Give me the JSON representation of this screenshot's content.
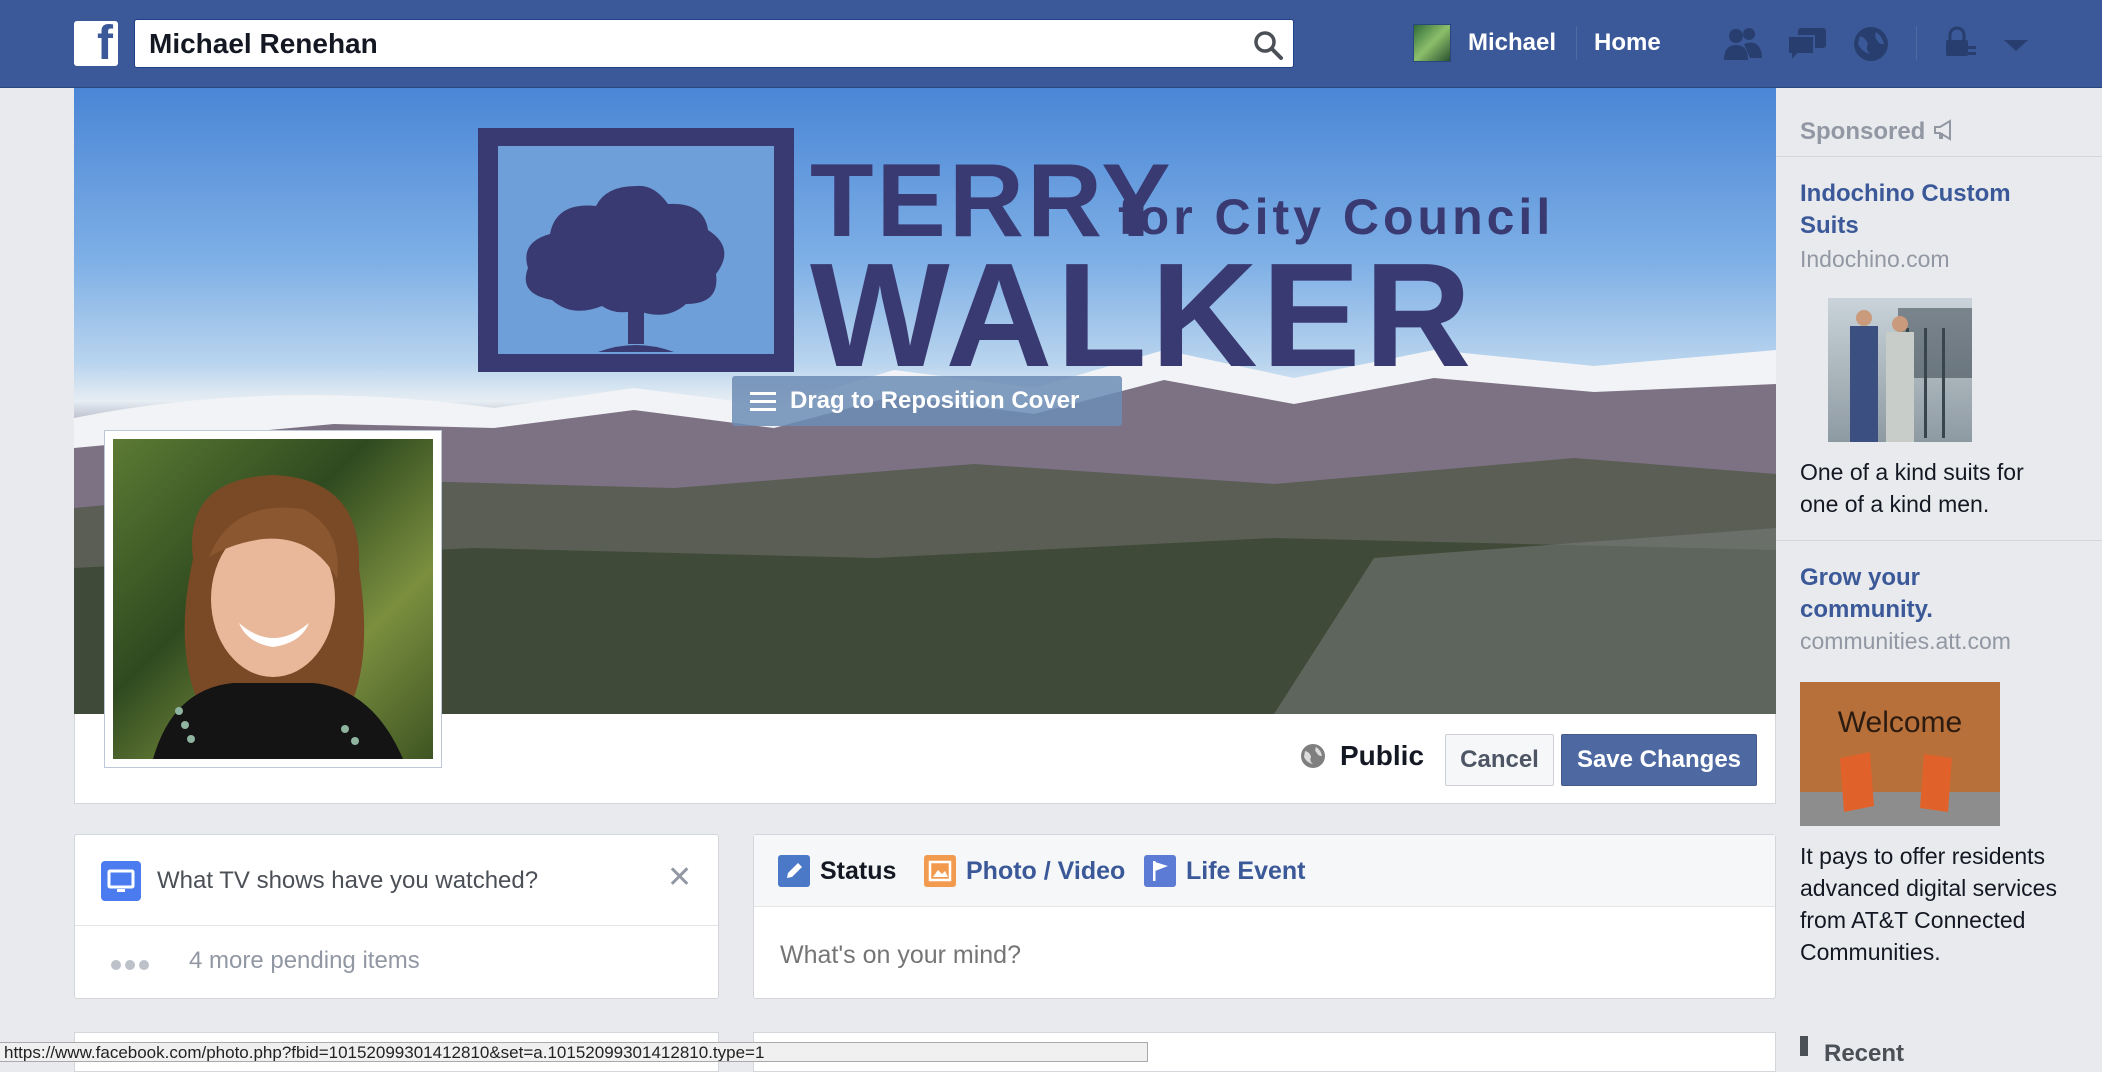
{
  "topbar": {
    "search_value": "Michael Renehan",
    "user_name": "Michael",
    "home_label": "Home",
    "icons": [
      "facebook-logo",
      "search-icon",
      "friend-requests-icon",
      "messages-icon",
      "notifications-globe-icon",
      "privacy-lock-icon",
      "account-menu-chevron-icon"
    ]
  },
  "cover": {
    "logo_line1": "TERRY",
    "logo_line2": "for City Council",
    "logo_line3": "WALKER",
    "drag_label": "Drag to Reposition Cover"
  },
  "header_actions": {
    "privacy_label": "Public",
    "cancel_label": "Cancel",
    "save_label": "Save Changes"
  },
  "tv_card": {
    "question": "What TV shows have you watched?",
    "close_glyph": "✕",
    "pending": "4 more pending items"
  },
  "composer": {
    "tabs": [
      {
        "label": "Status",
        "icon": "pencil-icon"
      },
      {
        "label": "Photo / Video",
        "icon": "photo-icon"
      },
      {
        "label": "Life Event",
        "icon": "flag-icon"
      }
    ],
    "placeholder": "What's on your mind?"
  },
  "sidebar": {
    "sponsored_label": "Sponsored",
    "ads": [
      {
        "title": "Indochino Custom Suits",
        "domain": "Indochino.com",
        "body": "One of a kind suits for one of a kind men."
      },
      {
        "title": "Grow your community.",
        "domain": "communities.att.com",
        "body": "It pays to offer residents advanced digital services from AT&T Connected Communities.",
        "image_text": "Welcome"
      }
    ],
    "recent_label": "Recent"
  },
  "status_bar": {
    "url": "https://www.facebook.com/photo.php?fbid=10152099301412810&set=a.10152099301412810.type=1"
  },
  "colors": {
    "topbar": "#3b5998",
    "link": "#3b5998",
    "save_button": "#4e69a2",
    "cover_logo": "#3a3a72"
  }
}
